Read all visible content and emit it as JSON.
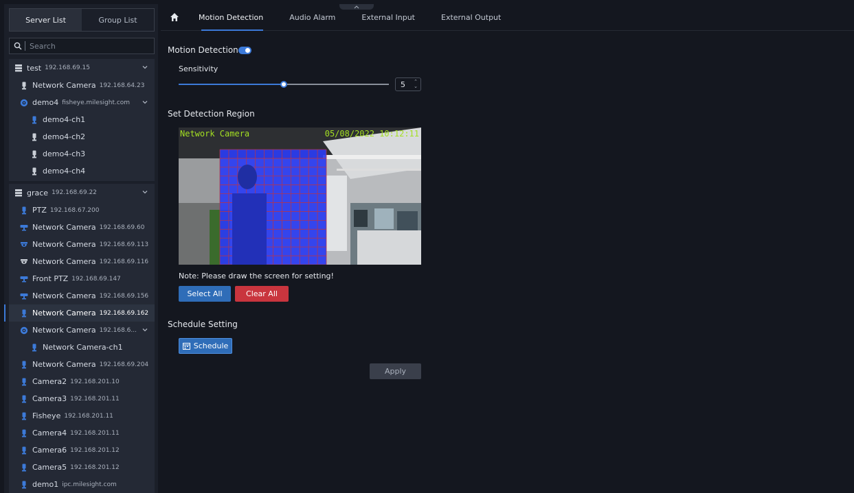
{
  "sidebar": {
    "tabs": [
      "Server List",
      "Group List"
    ],
    "search_placeholder": "Search",
    "group1": {
      "header": {
        "name": "test",
        "ip": "192.168.69.15"
      },
      "items": [
        {
          "name": "Network Camera",
          "ip": "192.168.64.23"
        },
        {
          "name": "demo4",
          "ip": "fisheye.milesight.com"
        },
        {
          "name": "demo4-ch1",
          "ip": ""
        },
        {
          "name": "demo4-ch2",
          "ip": ""
        },
        {
          "name": "demo4-ch3",
          "ip": ""
        },
        {
          "name": "demo4-ch4",
          "ip": ""
        }
      ]
    },
    "group2": {
      "header": {
        "name": "grace",
        "ip": "192.168.69.22"
      },
      "items": [
        {
          "name": "PTZ",
          "ip": "192.168.67.200"
        },
        {
          "name": "Network Camera",
          "ip": "192.168.69.60"
        },
        {
          "name": "Network Camera",
          "ip": "192.168.69.113"
        },
        {
          "name": "Network Camera",
          "ip": "192.168.69.116"
        },
        {
          "name": "Front PTZ",
          "ip": "192.168.69.147"
        },
        {
          "name": "Network Camera",
          "ip": "192.168.69.156"
        },
        {
          "name": "Network Camera",
          "ip": "192.168.69.162"
        },
        {
          "name": "Network Camera",
          "ip": "192.168.6..."
        },
        {
          "name": "Network Camera-ch1",
          "ip": ""
        },
        {
          "name": "Network Camera",
          "ip": "192.168.69.204"
        },
        {
          "name": "Camera2",
          "ip": "192.168.201.10"
        },
        {
          "name": "Camera3",
          "ip": "192.168.201.11"
        },
        {
          "name": "Fisheye",
          "ip": "192.168.201.11"
        },
        {
          "name": "Camera4",
          "ip": "192.168.201.11"
        },
        {
          "name": "Camera6",
          "ip": "192.168.201.12"
        },
        {
          "name": "Camera5",
          "ip": "192.168.201.12"
        },
        {
          "name": "demo1",
          "ip": "ipc.milesight.com"
        }
      ]
    }
  },
  "nav": {
    "tabs": [
      "Motion Detection",
      "Audio Alarm",
      "External Input",
      "External Output"
    ]
  },
  "motion": {
    "title": "Motion Detection",
    "enabled": true,
    "sensitivity_label": "Sensitivity",
    "sensitivity_value": "5",
    "sensitivity_max": 10
  },
  "region": {
    "title": "Set Detection Region",
    "osd_name": "Network Camera",
    "osd_time": "05/08/2022  10:12:11",
    "note": "Note: Please draw the screen for setting!",
    "select_all": "Select All",
    "clear_all": "Clear All"
  },
  "schedule": {
    "title": "Schedule Setting",
    "button": "Schedule"
  },
  "apply": "Apply",
  "colors": {
    "accent": "#3c7ad9",
    "select_btn": "#2f6db8",
    "clear_btn": "#c9353e",
    "region_fill": "#2a3cf0",
    "osd": "#a4e022"
  }
}
